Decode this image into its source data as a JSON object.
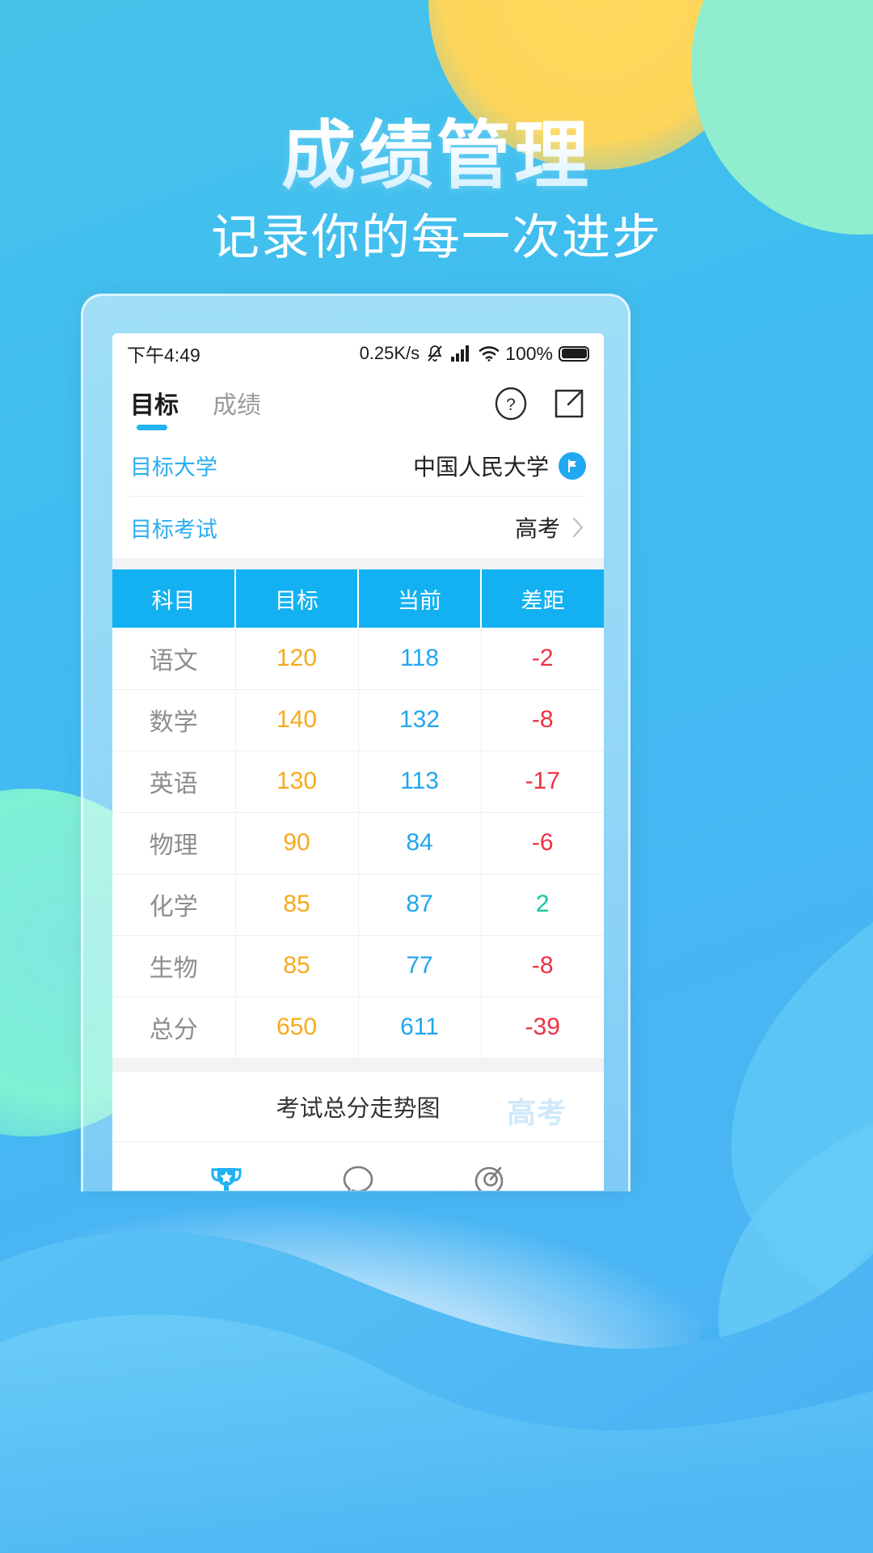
{
  "hero": {
    "title": "成绩管理",
    "subtitle": "记录你的每一次进步"
  },
  "statusbar": {
    "time": "下午4:49",
    "network_speed": "0.25K/s",
    "mute_icon": "bell-muted-icon",
    "signal_icon": "cellular-signal-icon",
    "wifi_icon": "wifi-icon",
    "battery_percent": "100%",
    "battery_icon": "battery-full-icon"
  },
  "tabs": [
    {
      "label": "目标",
      "active": true
    },
    {
      "label": "成绩",
      "active": false
    }
  ],
  "tab_actions": [
    {
      "name": "help-icon",
      "label": "?"
    },
    {
      "name": "share-external-icon",
      "label": ""
    }
  ],
  "info_rows": [
    {
      "label": "目标大学",
      "value": "中国人民大学",
      "trailing": "flag-badge-icon"
    },
    {
      "label": "目标考试",
      "value": "高考",
      "trailing": "chevron-right-icon"
    }
  ],
  "table": {
    "headers": [
      "科目",
      "目标",
      "当前",
      "差距"
    ],
    "rows": [
      {
        "subject": "语文",
        "target": "120",
        "current": "118",
        "gap": "-2",
        "gap_sign": "neg"
      },
      {
        "subject": "数学",
        "target": "140",
        "current": "132",
        "gap": "-8",
        "gap_sign": "neg"
      },
      {
        "subject": "英语",
        "target": "130",
        "current": "113",
        "gap": "-17",
        "gap_sign": "neg"
      },
      {
        "subject": "物理",
        "target": "90",
        "current": "84",
        "gap": "-6",
        "gap_sign": "neg"
      },
      {
        "subject": "化学",
        "target": "85",
        "current": "87",
        "gap": "2",
        "gap_sign": "pos"
      },
      {
        "subject": "生物",
        "target": "85",
        "current": "77",
        "gap": "-8",
        "gap_sign": "neg"
      },
      {
        "subject": "总分",
        "target": "650",
        "current": "611",
        "gap": "-39",
        "gap_sign": "neg"
      }
    ]
  },
  "chart_section": {
    "title": "考试总分走势图",
    "watermark": "高考"
  },
  "navbar": [
    {
      "name": "trophy-icon",
      "active": true
    },
    {
      "name": "chat-bubble-icon",
      "active": false
    },
    {
      "name": "target-camera-icon",
      "active": false
    }
  ],
  "colors": {
    "background_blue": "#45b7f2",
    "accent_blue": "#13b1f2",
    "target_orange": "#f5aa1c",
    "current_blue": "#22a6ef",
    "gap_negative_red": "#ef3144",
    "gap_positive_green": "#13c79b",
    "yellow_blob": "#fdd55a",
    "mint_blob": "#90eecd"
  }
}
